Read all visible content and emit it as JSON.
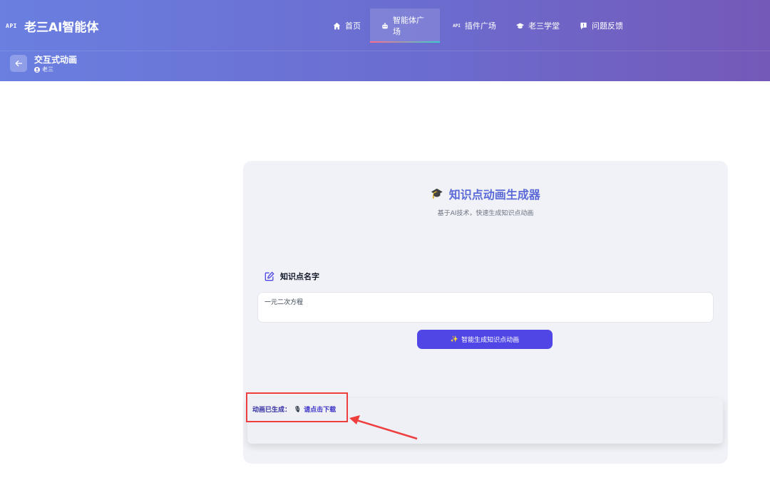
{
  "header": {
    "api_badge": "API",
    "title": "老三AI智能体",
    "nav": [
      {
        "label": "首页",
        "icon": "home-icon"
      },
      {
        "label": "智能体广场",
        "icon": "robot-icon",
        "active": true
      },
      {
        "label": "插件广场",
        "icon": "api-icon",
        "badge": "API"
      },
      {
        "label": "老三学堂",
        "icon": "graduation-cap-icon"
      },
      {
        "label": "问题反馈",
        "icon": "feedback-icon"
      }
    ]
  },
  "subheader": {
    "title": "交互式动画",
    "author": "老三"
  },
  "card": {
    "title": "知识点动画生成器",
    "title_icon": "🎓",
    "subtitle": "基于AI技术，快速生成知识点动画",
    "field_label": "知识点名字",
    "input_value": "一元二次方程",
    "generate_button": "智能生成知识点动画",
    "generate_icon": "✨",
    "result_label": "动画已生成：",
    "result_icon": "🎙",
    "result_link": "请点击下载"
  },
  "colors": {
    "header_gradient_start": "#6a7fe0",
    "header_gradient_end": "#7459b8",
    "accent": "#5046e5",
    "annotation": "#ef3e3e"
  }
}
